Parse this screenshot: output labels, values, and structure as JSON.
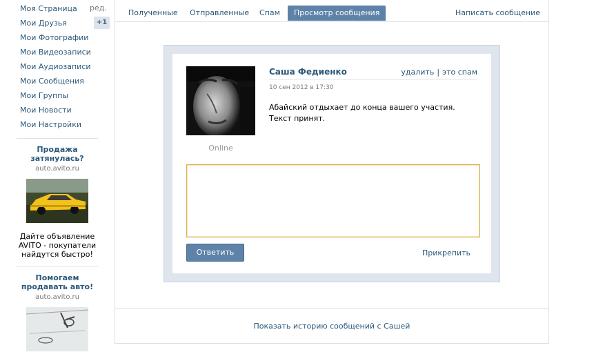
{
  "sidebar": {
    "items": [
      {
        "label": "Моя Страница"
      },
      {
        "label": "Мои Друзья"
      },
      {
        "label": "Мои Фотографии"
      },
      {
        "label": "Мои Видеозаписи"
      },
      {
        "label": "Мои Аудиозаписи"
      },
      {
        "label": "Мои Сообщения"
      },
      {
        "label": "Мои Группы"
      },
      {
        "label": "Мои Новости"
      },
      {
        "label": "Мои Настройки"
      }
    ],
    "edit_label": "ред.",
    "friends_badge": "+1"
  },
  "ads": [
    {
      "title": "Продажа затянулась?",
      "domain": "auto.avito.ru",
      "text": "Дайте объявление AVITO - покупатели найдутся быстро!"
    },
    {
      "title": "Помогаем продавать авто!",
      "domain": "auto.avito.ru"
    }
  ],
  "tabs": [
    {
      "label": "Полученные"
    },
    {
      "label": "Отправленные"
    },
    {
      "label": "Спам"
    },
    {
      "label": "Просмотр сообщения",
      "active": true
    }
  ],
  "write_message_label": "Написать сообщение",
  "message": {
    "sender": "Саша Федиенко",
    "status": "Online",
    "date": "10 сен 2012 в 17:30",
    "delete_label": "удалить",
    "spam_label": "это спам",
    "separator": "|",
    "lines": [
      "Абайский отдыхает до конца вашего участия.",
      "Текст принят."
    ]
  },
  "reply": {
    "button_label": "Ответить",
    "attach_label": "Прикрепить"
  },
  "history_link": "Показать историю сообщений с Сашей",
  "colors": {
    "link": "#2b587a",
    "accent": "#5e82a8",
    "reply_border": "#dcb052",
    "frame_bg": "#dee5ec"
  }
}
